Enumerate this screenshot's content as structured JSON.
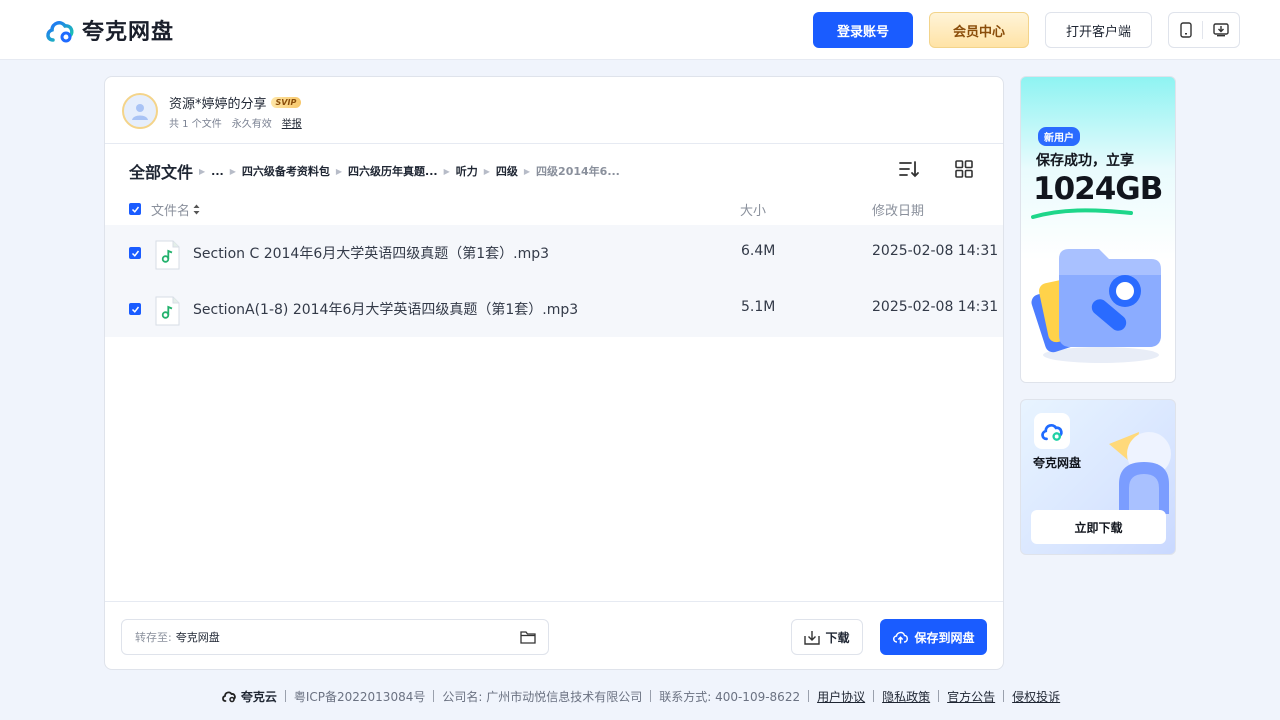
{
  "header": {
    "logo_text": "夸克网盘",
    "login_label": "登录账号",
    "vip_label": "会员中心",
    "client_label": "打开客户端"
  },
  "share": {
    "title": "资源*婷婷的分享",
    "badge": "SVIP",
    "file_count": "共 1 个文件",
    "validity": "永久有效",
    "report": "举报"
  },
  "breadcrumb": {
    "root": "全部文件",
    "items": [
      "...",
      "四六级备考资料包",
      "四六级历年真题...",
      "听力",
      "四级"
    ],
    "current": "四级2014年6..."
  },
  "table": {
    "columns": {
      "name": "文件名",
      "size": "大小",
      "date": "修改日期"
    },
    "rows": [
      {
        "name": "Section C 2014年6月大学英语四级真题（第1套）.mp3",
        "size": "6.4M",
        "date": "2025-02-08 14:31"
      },
      {
        "name": "SectionA(1-8) 2014年6月大学英语四级真题（第1套）.mp3",
        "size": "5.1M",
        "date": "2025-02-08 14:31"
      }
    ]
  },
  "actions": {
    "save_to_label": "转存至:",
    "save_to_value": "夸克网盘",
    "download_label": "下载",
    "save_label": "保存到网盘"
  },
  "ads": {
    "promo_tag": "新用户",
    "promo_line": "保存成功，立享",
    "promo_big": "1024GB",
    "app_name": "夸克网盘",
    "app_download": "立即下载"
  },
  "footer": {
    "brand": "夸克云",
    "icp": "粤ICP备2022013084号",
    "company": "公司名: 广州市动悦信息技术有限公司",
    "contact": "联系方式: 400-109-8622",
    "links": [
      "用户协议",
      "隐私政策",
      "官方公告",
      "侵权投诉"
    ]
  },
  "colors": {
    "accent": "#1a5cff",
    "page_bg": "#f0f4fc",
    "row_bg": "#f5f7fb",
    "vip_gold": "#ffe3a6"
  }
}
